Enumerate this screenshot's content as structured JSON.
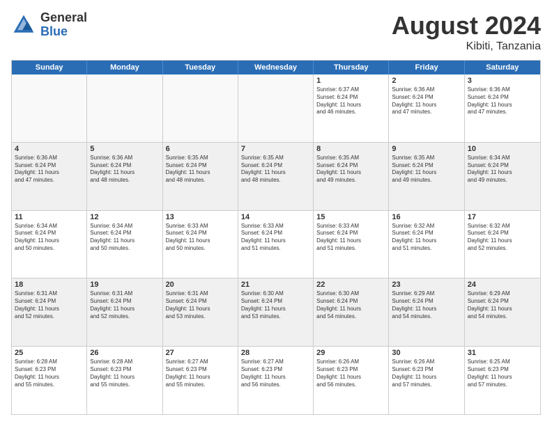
{
  "logo": {
    "general": "General",
    "blue": "Blue"
  },
  "header": {
    "title": "August 2024",
    "subtitle": "Kibiti, Tanzania"
  },
  "weekdays": [
    "Sunday",
    "Monday",
    "Tuesday",
    "Wednesday",
    "Thursday",
    "Friday",
    "Saturday"
  ],
  "weeks": [
    [
      {
        "day": "",
        "info": "",
        "shaded": true
      },
      {
        "day": "",
        "info": "",
        "shaded": true
      },
      {
        "day": "",
        "info": "",
        "shaded": true
      },
      {
        "day": "",
        "info": "",
        "shaded": true
      },
      {
        "day": "1",
        "info": "Sunrise: 6:37 AM\nSunset: 6:24 PM\nDaylight: 11 hours\nand 46 minutes.",
        "shaded": false
      },
      {
        "day": "2",
        "info": "Sunrise: 6:36 AM\nSunset: 6:24 PM\nDaylight: 11 hours\nand 47 minutes.",
        "shaded": false
      },
      {
        "day": "3",
        "info": "Sunrise: 6:36 AM\nSunset: 6:24 PM\nDaylight: 11 hours\nand 47 minutes.",
        "shaded": false
      }
    ],
    [
      {
        "day": "4",
        "info": "Sunrise: 6:36 AM\nSunset: 6:24 PM\nDaylight: 11 hours\nand 47 minutes.",
        "shaded": true
      },
      {
        "day": "5",
        "info": "Sunrise: 6:36 AM\nSunset: 6:24 PM\nDaylight: 11 hours\nand 48 minutes.",
        "shaded": true
      },
      {
        "day": "6",
        "info": "Sunrise: 6:35 AM\nSunset: 6:24 PM\nDaylight: 11 hours\nand 48 minutes.",
        "shaded": true
      },
      {
        "day": "7",
        "info": "Sunrise: 6:35 AM\nSunset: 6:24 PM\nDaylight: 11 hours\nand 48 minutes.",
        "shaded": true
      },
      {
        "day": "8",
        "info": "Sunrise: 6:35 AM\nSunset: 6:24 PM\nDaylight: 11 hours\nand 49 minutes.",
        "shaded": true
      },
      {
        "day": "9",
        "info": "Sunrise: 6:35 AM\nSunset: 6:24 PM\nDaylight: 11 hours\nand 49 minutes.",
        "shaded": true
      },
      {
        "day": "10",
        "info": "Sunrise: 6:34 AM\nSunset: 6:24 PM\nDaylight: 11 hours\nand 49 minutes.",
        "shaded": true
      }
    ],
    [
      {
        "day": "11",
        "info": "Sunrise: 6:34 AM\nSunset: 6:24 PM\nDaylight: 11 hours\nand 50 minutes.",
        "shaded": false
      },
      {
        "day": "12",
        "info": "Sunrise: 6:34 AM\nSunset: 6:24 PM\nDaylight: 11 hours\nand 50 minutes.",
        "shaded": false
      },
      {
        "day": "13",
        "info": "Sunrise: 6:33 AM\nSunset: 6:24 PM\nDaylight: 11 hours\nand 50 minutes.",
        "shaded": false
      },
      {
        "day": "14",
        "info": "Sunrise: 6:33 AM\nSunset: 6:24 PM\nDaylight: 11 hours\nand 51 minutes.",
        "shaded": false
      },
      {
        "day": "15",
        "info": "Sunrise: 6:33 AM\nSunset: 6:24 PM\nDaylight: 11 hours\nand 51 minutes.",
        "shaded": false
      },
      {
        "day": "16",
        "info": "Sunrise: 6:32 AM\nSunset: 6:24 PM\nDaylight: 11 hours\nand 51 minutes.",
        "shaded": false
      },
      {
        "day": "17",
        "info": "Sunrise: 6:32 AM\nSunset: 6:24 PM\nDaylight: 11 hours\nand 52 minutes.",
        "shaded": false
      }
    ],
    [
      {
        "day": "18",
        "info": "Sunrise: 6:31 AM\nSunset: 6:24 PM\nDaylight: 11 hours\nand 52 minutes.",
        "shaded": true
      },
      {
        "day": "19",
        "info": "Sunrise: 6:31 AM\nSunset: 6:24 PM\nDaylight: 11 hours\nand 52 minutes.",
        "shaded": true
      },
      {
        "day": "20",
        "info": "Sunrise: 6:31 AM\nSunset: 6:24 PM\nDaylight: 11 hours\nand 53 minutes.",
        "shaded": true
      },
      {
        "day": "21",
        "info": "Sunrise: 6:30 AM\nSunset: 6:24 PM\nDaylight: 11 hours\nand 53 minutes.",
        "shaded": true
      },
      {
        "day": "22",
        "info": "Sunrise: 6:30 AM\nSunset: 6:24 PM\nDaylight: 11 hours\nand 54 minutes.",
        "shaded": true
      },
      {
        "day": "23",
        "info": "Sunrise: 6:29 AM\nSunset: 6:24 PM\nDaylight: 11 hours\nand 54 minutes.",
        "shaded": true
      },
      {
        "day": "24",
        "info": "Sunrise: 6:29 AM\nSunset: 6:24 PM\nDaylight: 11 hours\nand 54 minutes.",
        "shaded": true
      }
    ],
    [
      {
        "day": "25",
        "info": "Sunrise: 6:28 AM\nSunset: 6:23 PM\nDaylight: 11 hours\nand 55 minutes.",
        "shaded": false
      },
      {
        "day": "26",
        "info": "Sunrise: 6:28 AM\nSunset: 6:23 PM\nDaylight: 11 hours\nand 55 minutes.",
        "shaded": false
      },
      {
        "day": "27",
        "info": "Sunrise: 6:27 AM\nSunset: 6:23 PM\nDaylight: 11 hours\nand 55 minutes.",
        "shaded": false
      },
      {
        "day": "28",
        "info": "Sunrise: 6:27 AM\nSunset: 6:23 PM\nDaylight: 11 hours\nand 56 minutes.",
        "shaded": false
      },
      {
        "day": "29",
        "info": "Sunrise: 6:26 AM\nSunset: 6:23 PM\nDaylight: 11 hours\nand 56 minutes.",
        "shaded": false
      },
      {
        "day": "30",
        "info": "Sunrise: 6:26 AM\nSunset: 6:23 PM\nDaylight: 11 hours\nand 57 minutes.",
        "shaded": false
      },
      {
        "day": "31",
        "info": "Sunrise: 6:25 AM\nSunset: 6:23 PM\nDaylight: 11 hours\nand 57 minutes.",
        "shaded": false
      }
    ]
  ]
}
